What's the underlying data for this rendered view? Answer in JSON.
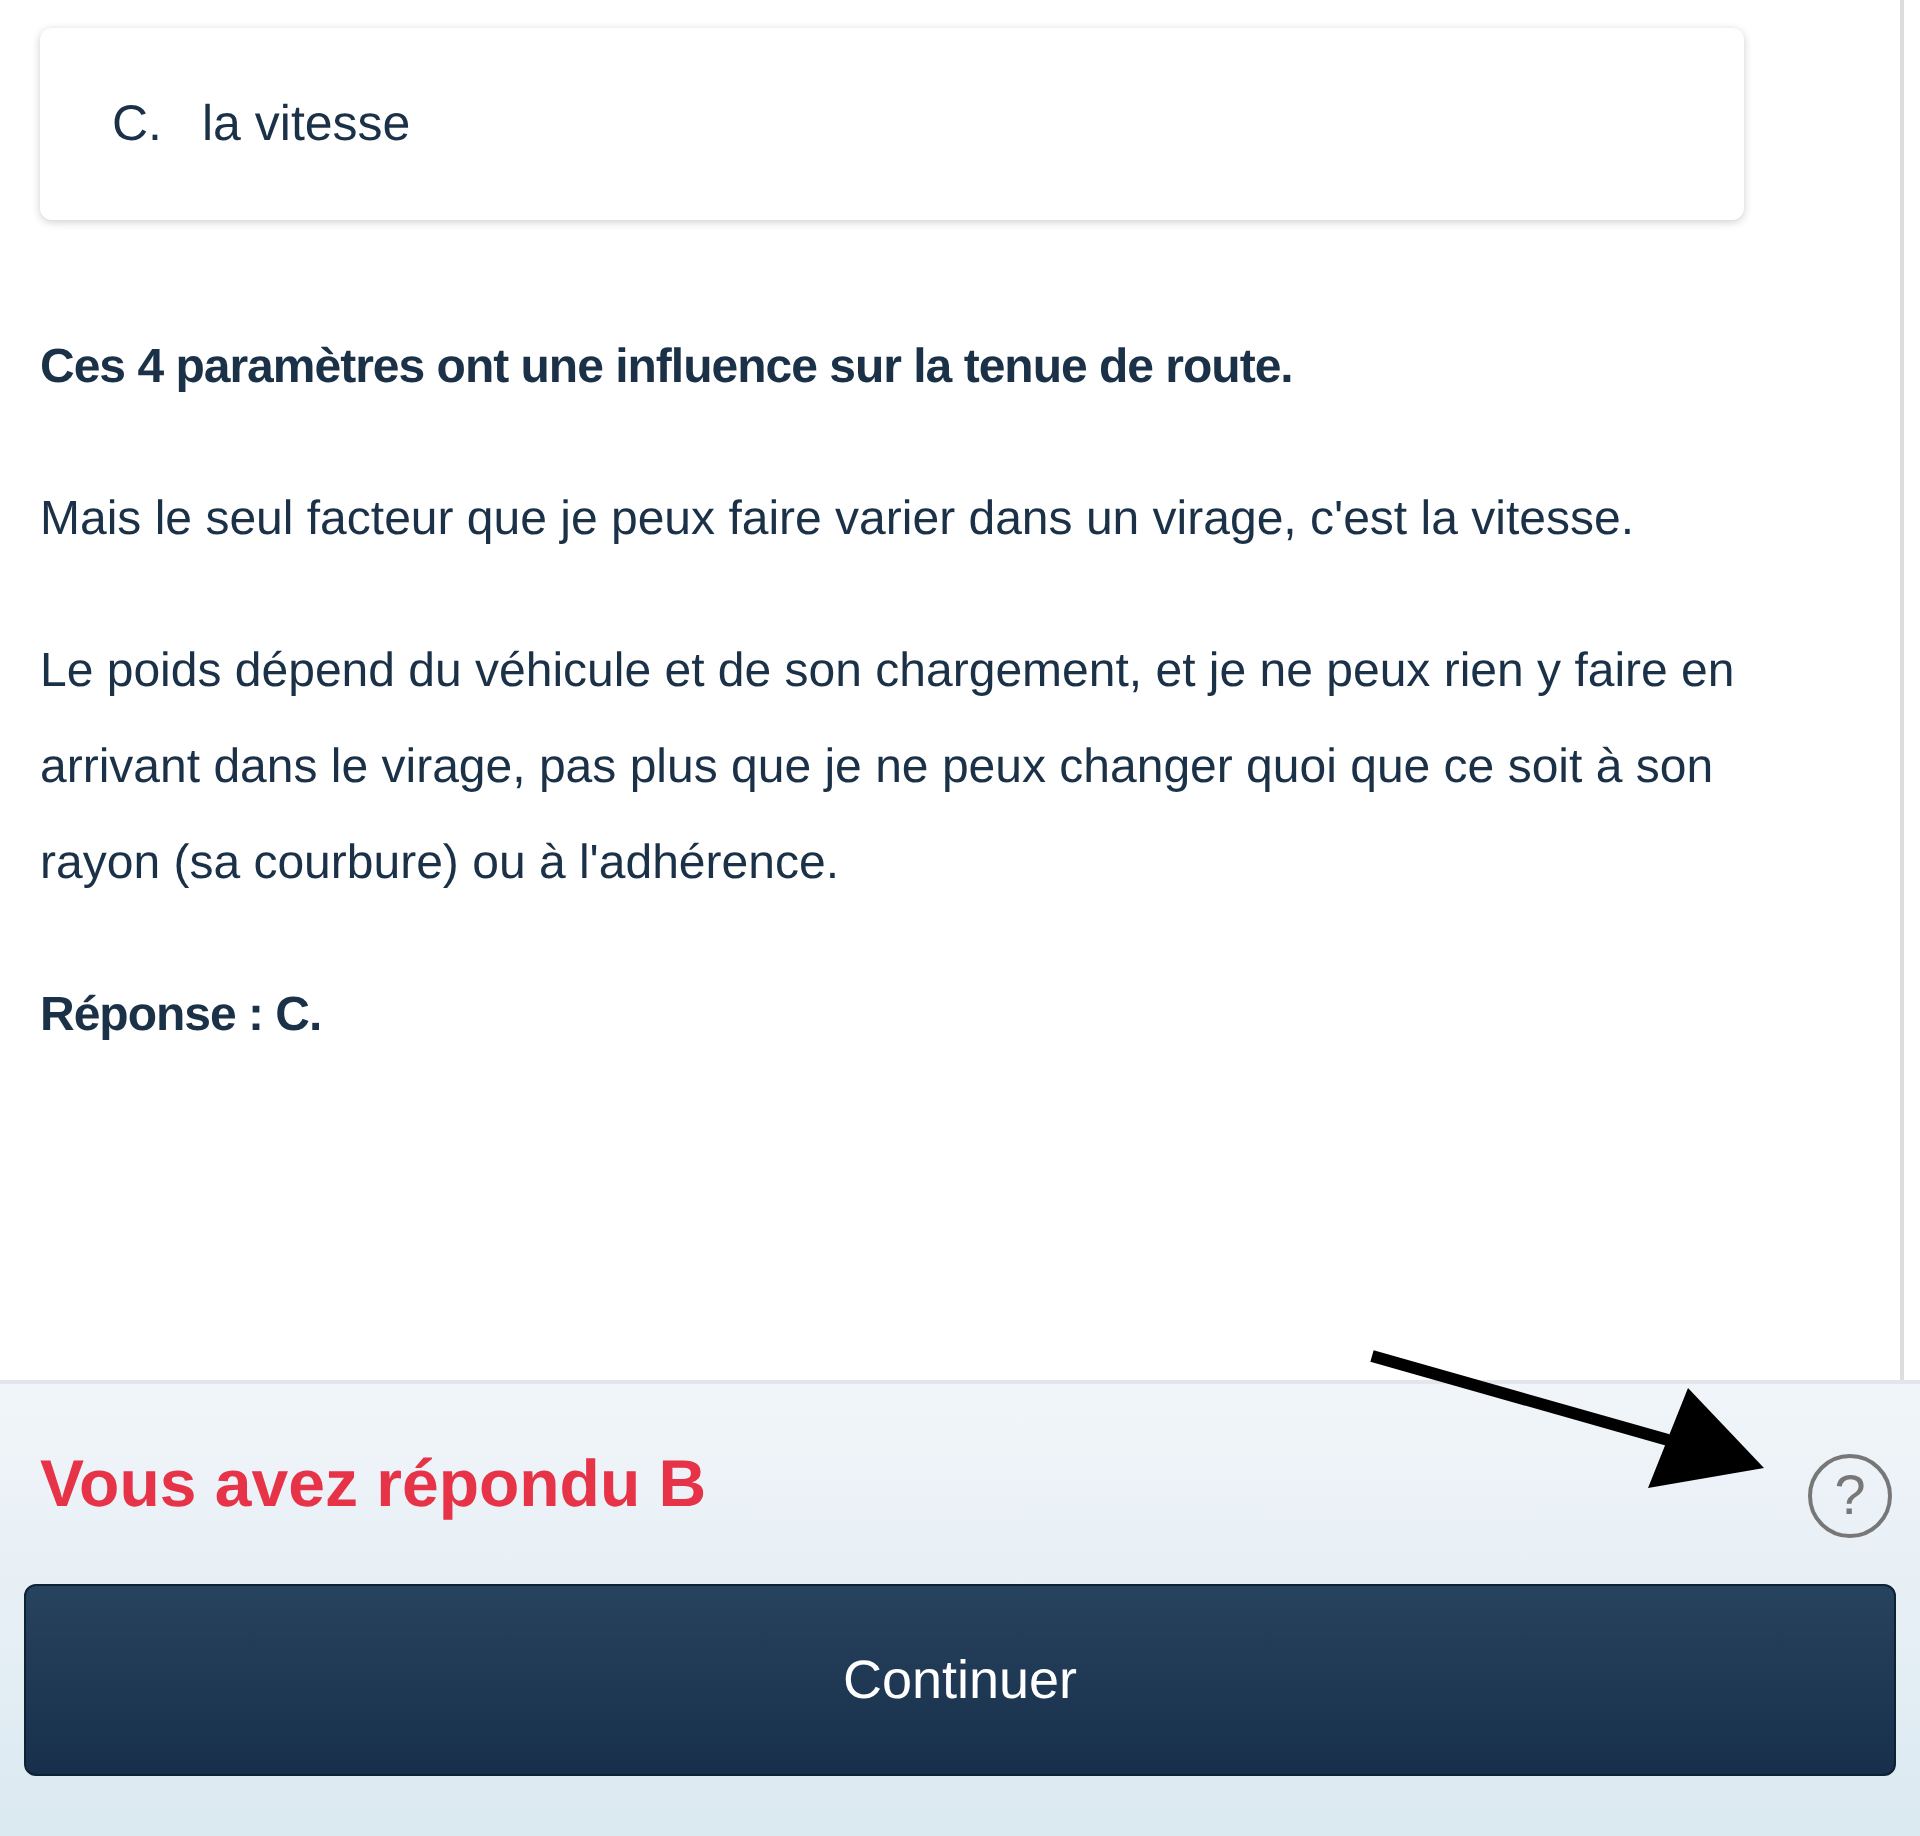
{
  "option": {
    "letter": "C.",
    "text": "la vitesse"
  },
  "explanation": [
    {
      "kind": "bold",
      "text": "Ces 4 paramètres ont une influence sur la tenue de route."
    },
    {
      "kind": "plain",
      "text": "Mais le seul facteur que je peux faire varier dans un virage, c'est la vitesse."
    },
    {
      "kind": "plain",
      "text": "Le poids dépend du véhicule et de son chargement, et je ne peux rien y faire en arrivant dans le virage, pas plus que je ne peux changer quoi que ce soit à son rayon (sa courbure) ou à l'adhérence."
    },
    {
      "kind": "bold",
      "text": "Réponse : C."
    }
  ],
  "result": {
    "text": "Vous avez répondu B",
    "correct": false
  },
  "help": {
    "symbol": "?"
  },
  "button": "Continuer"
}
